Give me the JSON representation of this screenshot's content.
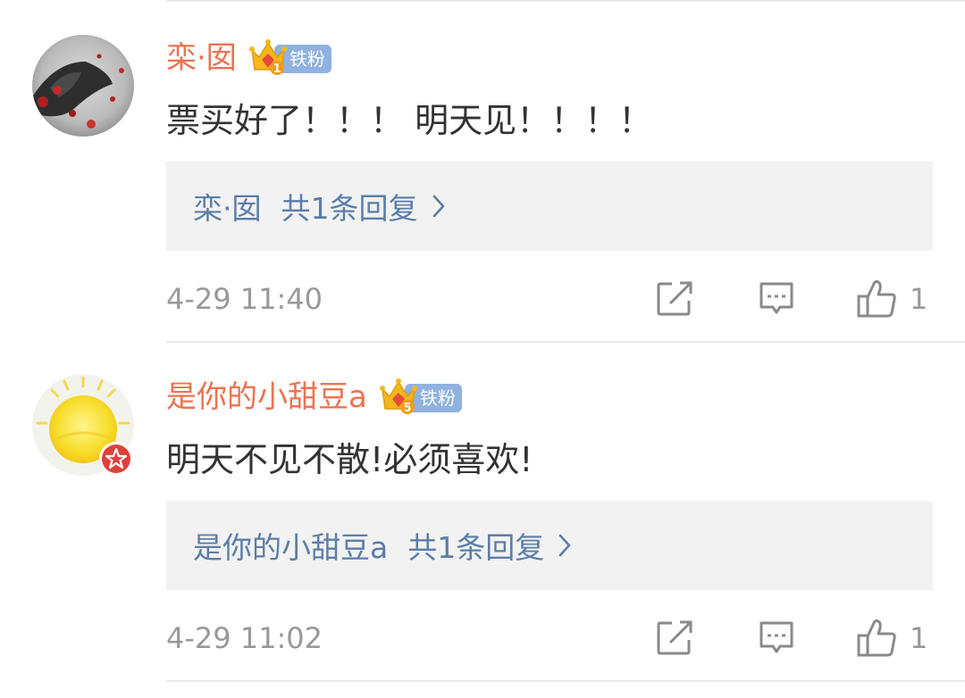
{
  "colors": {
    "username": "#eb7350",
    "reply_link": "#5b7ea9",
    "text": "#333333",
    "meta": "#999999",
    "fan_badge": "#8fb2e0",
    "reply_bg": "#f2f2f2",
    "verified_badge": "#e0403a"
  },
  "comments": [
    {
      "username": "栾·囡",
      "fan_badge": {
        "crown_level": "1",
        "label": "铁粉",
        "icon": "crown-icon"
      },
      "text": "票买好了！！！ 明天见！！！！",
      "reply": {
        "author": "栾·囡",
        "summary": "共1条回复",
        "icon": "chevron-right-icon"
      },
      "timestamp": "4-29 11:40",
      "likes": "1",
      "actions": [
        "repost-icon",
        "comment-icon",
        "like-icon"
      ]
    },
    {
      "username": "是你的小甜豆a",
      "fan_badge": {
        "crown_level": "5",
        "label": "铁粉",
        "icon": "crown-icon"
      },
      "text": "明天不见不散!必须喜欢!",
      "reply": {
        "author": "是你的小甜豆a",
        "summary": "共1条回复",
        "icon": "chevron-right-icon"
      },
      "timestamp": "4-29 11:02",
      "likes": "1",
      "verified_icon": "verified-star-icon",
      "actions": [
        "repost-icon",
        "comment-icon",
        "like-icon"
      ]
    }
  ]
}
